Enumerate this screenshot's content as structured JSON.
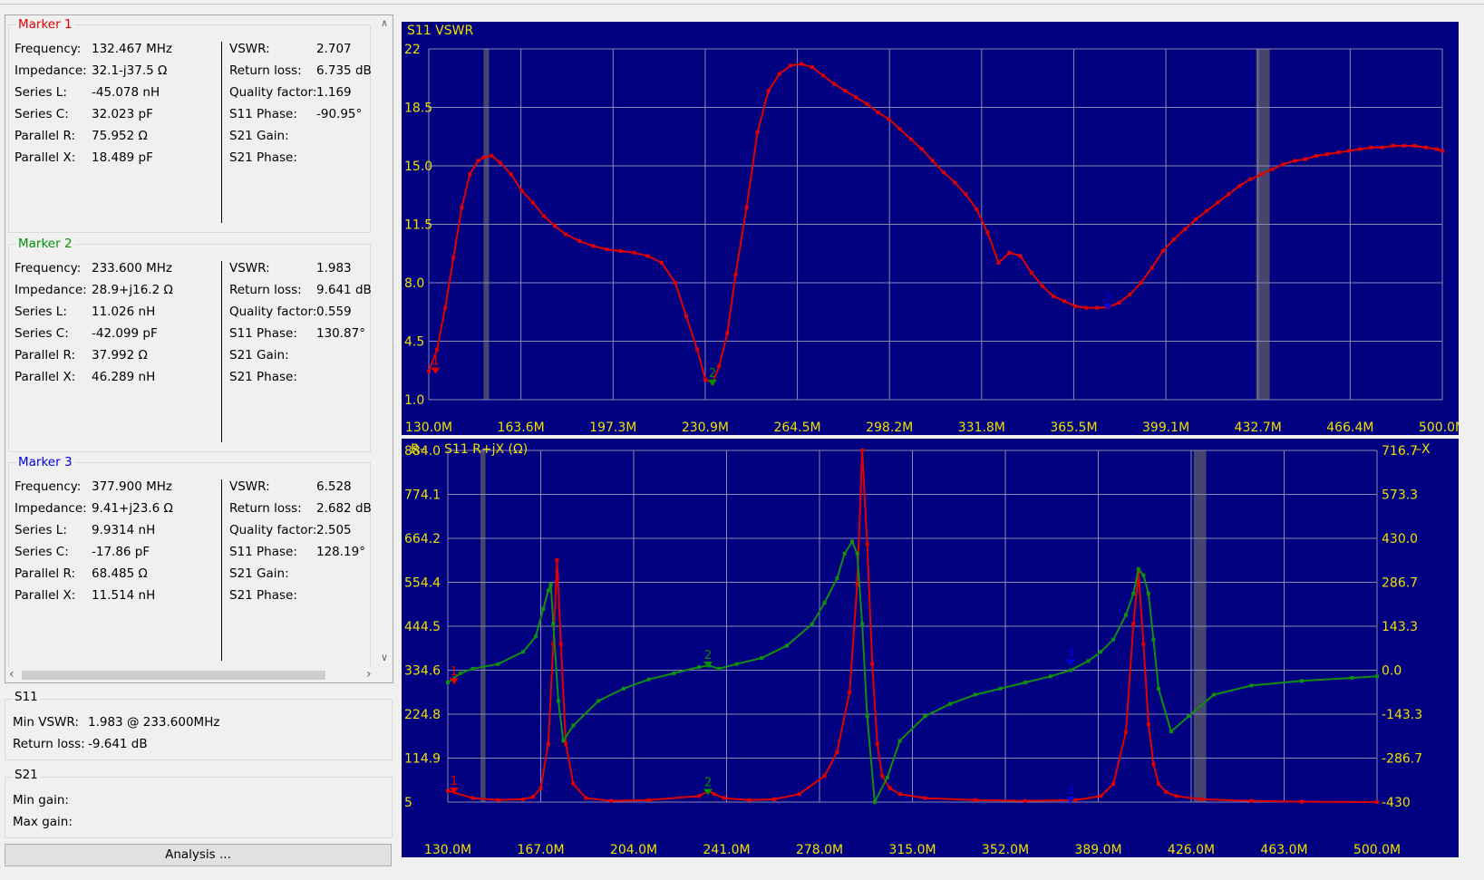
{
  "markers": [
    {
      "title": "Marker 1",
      "color": "#e00000",
      "left": [
        {
          "label": "Frequency:",
          "value": "132.467 MHz"
        },
        {
          "label": "Impedance:",
          "value": "32.1-j37.5 Ω"
        },
        {
          "label": "Series L:",
          "value": "-45.078 nH"
        },
        {
          "label": "Series C:",
          "value": "32.023 pF"
        },
        {
          "label": "Parallel R:",
          "value": "75.952 Ω"
        },
        {
          "label": "Parallel X:",
          "value": "18.489 pF"
        }
      ],
      "right": [
        {
          "label": "VSWR:",
          "value": "2.707"
        },
        {
          "label": "Return loss:",
          "value": "6.735 dB"
        },
        {
          "label": "Quality factor:",
          "value": "1.169"
        },
        {
          "label": "S11 Phase:",
          "value": "-90.95°"
        },
        {
          "label": "S21 Gain:",
          "value": ""
        },
        {
          "label": "S21 Phase:",
          "value": ""
        }
      ]
    },
    {
      "title": "Marker 2",
      "color": "#009000",
      "left": [
        {
          "label": "Frequency:",
          "value": "233.600 MHz"
        },
        {
          "label": "Impedance:",
          "value": "28.9+j16.2 Ω"
        },
        {
          "label": "Series L:",
          "value": "11.026 nH"
        },
        {
          "label": "Series C:",
          "value": "-42.099 pF"
        },
        {
          "label": "Parallel R:",
          "value": "37.992 Ω"
        },
        {
          "label": "Parallel X:",
          "value": "46.289 nH"
        }
      ],
      "right": [
        {
          "label": "VSWR:",
          "value": "1.983"
        },
        {
          "label": "Return loss:",
          "value": "9.641 dB"
        },
        {
          "label": "Quality factor:",
          "value": "0.559"
        },
        {
          "label": "S11 Phase:",
          "value": "130.87°"
        },
        {
          "label": "S21 Gain:",
          "value": ""
        },
        {
          "label": "S21 Phase:",
          "value": ""
        }
      ]
    },
    {
      "title": "Marker 3",
      "color": "#0000e0",
      "left": [
        {
          "label": "Frequency:",
          "value": "377.900 MHz"
        },
        {
          "label": "Impedance:",
          "value": "9.41+j23.6 Ω"
        },
        {
          "label": "Series L:",
          "value": "9.9314 nH"
        },
        {
          "label": "Series C:",
          "value": "-17.86 pF"
        },
        {
          "label": "Parallel R:",
          "value": "68.485 Ω"
        },
        {
          "label": "Parallel X:",
          "value": "11.514 nH"
        }
      ],
      "right": [
        {
          "label": "VSWR:",
          "value": "6.528"
        },
        {
          "label": "Return loss:",
          "value": "2.682 dB"
        },
        {
          "label": "Quality factor:",
          "value": "2.505"
        },
        {
          "label": "S11 Phase:",
          "value": "128.19°"
        },
        {
          "label": "S21 Gain:",
          "value": ""
        },
        {
          "label": "S21 Phase:",
          "value": ""
        }
      ]
    }
  ],
  "s11_summary": {
    "title": "S11",
    "min_vswr_label": "Min VSWR:",
    "min_vswr_value": "1.983 @ 233.600MHz",
    "return_loss_label": "Return loss:",
    "return_loss_value": "-9.641 dB"
  },
  "s21_summary": {
    "title": "S21",
    "min_gain_label": "Min gain:",
    "max_gain_label": "Max gain:"
  },
  "analysis_button": "Analysis ...",
  "chart_data": [
    {
      "type": "line",
      "title": "S11 VSWR",
      "x_tick_labels": [
        "130.0M",
        "163.6M",
        "197.3M",
        "230.9M",
        "264.5M",
        "298.2M",
        "331.8M",
        "365.5M",
        "399.1M",
        "432.7M",
        "466.4M",
        "500.0M"
      ],
      "y_tick_labels": [
        "22",
        "18.5",
        "15.0",
        "11.5",
        "8.0",
        "4.5",
        "1.0"
      ],
      "xlim": [
        130,
        500
      ],
      "ylim": [
        1,
        22
      ],
      "grid": true,
      "background": "#000080",
      "series": [
        {
          "color": "#e00000",
          "x": [
            130,
            133,
            136,
            139,
            142,
            145,
            148,
            150,
            153,
            156,
            160,
            164,
            168,
            172,
            176,
            180,
            185,
            190,
            195,
            200,
            205,
            210,
            215,
            220,
            224,
            228,
            231,
            233.6,
            236,
            239,
            242,
            246,
            250,
            254,
            258,
            262,
            266,
            270,
            274,
            278,
            282,
            286,
            290,
            294,
            298,
            302,
            306,
            310,
            314,
            318,
            322,
            326,
            330,
            334,
            338,
            342,
            346,
            350,
            354,
            358,
            362,
            366,
            370,
            374,
            377.9,
            382,
            386,
            390,
            394,
            398,
            402,
            406,
            410,
            414,
            418,
            422,
            426,
            430,
            434,
            438,
            442,
            446,
            450,
            454,
            458,
            462,
            466,
            470,
            474,
            478,
            482,
            486,
            490,
            494,
            498,
            500
          ],
          "y": [
            2.7,
            4.0,
            6.5,
            9.5,
            12.5,
            14.5,
            15.3,
            15.5,
            15.6,
            15.2,
            14.5,
            13.5,
            12.8,
            12.0,
            11.4,
            10.9,
            10.5,
            10.2,
            10.0,
            9.9,
            9.8,
            9.6,
            9.2,
            8.0,
            6.0,
            4.0,
            2.2,
            2.0,
            3.0,
            5.0,
            8.5,
            12.5,
            17.0,
            19.5,
            20.5,
            21.0,
            21.1,
            20.9,
            20.4,
            19.9,
            19.5,
            19.1,
            18.7,
            18.2,
            17.8,
            17.2,
            16.6,
            16.0,
            15.3,
            14.6,
            14.0,
            13.3,
            12.4,
            11.0,
            9.2,
            9.8,
            9.6,
            8.6,
            7.8,
            7.2,
            6.9,
            6.6,
            6.5,
            6.5,
            6.53,
            6.8,
            7.3,
            8.0,
            8.9,
            9.9,
            10.6,
            11.2,
            11.8,
            12.3,
            12.8,
            13.3,
            13.8,
            14.2,
            14.5,
            14.8,
            15.1,
            15.3,
            15.4,
            15.6,
            15.7,
            15.8,
            15.9,
            16.0,
            16.1,
            16.1,
            16.2,
            16.2,
            16.2,
            16.1,
            16.0,
            15.9
          ]
        }
      ],
      "markers": [
        {
          "label": "1",
          "x": 132.467,
          "y": 2.707,
          "color": "#e00000"
        },
        {
          "label": "2",
          "x": 233.6,
          "y": 1.983,
          "color": "#009000"
        },
        {
          "label": "3",
          "x": 377.9,
          "y": 6.528,
          "color": "#0000e0"
        }
      ],
      "shaded_bands": [
        [
          150,
          152
        ],
        [
          432,
          437
        ]
      ]
    },
    {
      "type": "line",
      "title": "S11 R+jX (Ω)",
      "left_axis_label": "R",
      "right_axis_label": "X",
      "x_tick_labels": [
        "130.0M",
        "167.0M",
        "204.0M",
        "241.0M",
        "278.0M",
        "315.0M",
        "352.0M",
        "389.0M",
        "426.0M",
        "463.0M",
        "500.0M"
      ],
      "y_tick_labels": [
        "884.0",
        "774.1",
        "664.2",
        "554.4",
        "444.5",
        "334.6",
        "224.8",
        "114.9",
        "5"
      ],
      "y2_tick_labels": [
        "716.7",
        "573.3",
        "430.0",
        "286.7",
        "143.3",
        "0.0",
        "-143.3",
        "-286.7",
        "-430"
      ],
      "xlim": [
        130,
        500
      ],
      "ylim": [
        5,
        884
      ],
      "y2lim": [
        -430,
        716.7
      ],
      "grid": true,
      "background": "#000080",
      "series": [
        {
          "name": "R",
          "color": "#e00000",
          "x": [
            130,
            140,
            150,
            160,
            164,
            167,
            170,
            172,
            173.5,
            175,
            177,
            180,
            185,
            195,
            210,
            230,
            234,
            236,
            240,
            250,
            260,
            270,
            280,
            285,
            290,
            293,
            295,
            297,
            299,
            301,
            303,
            306,
            310,
            320,
            340,
            360,
            380,
            390,
            395,
            400,
            403,
            405,
            407,
            409,
            411,
            413,
            416,
            420,
            430,
            450,
            470,
            500
          ],
          "y": [
            33,
            15,
            10,
            12,
            18,
            40,
            150,
            400,
            610,
            400,
            150,
            50,
            15,
            8,
            10,
            20,
            33,
            25,
            15,
            10,
            12,
            25,
            70,
            130,
            280,
            550,
            884,
            650,
            350,
            150,
            70,
            40,
            25,
            15,
            10,
            8,
            10,
            20,
            50,
            180,
            450,
            580,
            400,
            200,
            100,
            50,
            30,
            20,
            12,
            8,
            6,
            5
          ]
        },
        {
          "name": "X",
          "color": "#109010",
          "x": [
            130,
            135,
            140,
            150,
            160,
            165,
            168,
            170,
            171,
            172,
            174,
            176,
            180,
            190,
            200,
            210,
            220,
            230,
            234,
            238,
            245,
            255,
            265,
            275,
            280,
            285,
            288,
            291,
            293,
            295,
            297,
            300,
            305,
            310,
            320,
            330,
            340,
            350,
            360,
            370,
            378,
            385,
            390,
            395,
            400,
            403,
            405,
            407,
            409,
            411,
            413,
            418,
            425,
            435,
            450,
            470,
            490,
            500
          ],
          "y": [
            -40,
            -10,
            5,
            20,
            60,
            110,
            200,
            260,
            280,
            150,
            -100,
            -230,
            -180,
            -100,
            -60,
            -30,
            -10,
            10,
            15,
            5,
            20,
            40,
            80,
            150,
            220,
            300,
            380,
            420,
            380,
            150,
            -150,
            -430,
            -350,
            -230,
            -150,
            -110,
            -80,
            -60,
            -40,
            -20,
            0,
            30,
            60,
            100,
            180,
            250,
            330,
            310,
            250,
            100,
            -60,
            -200,
            -150,
            -80,
            -50,
            -35,
            -25,
            -20
          ]
        }
      ],
      "markers": [
        {
          "label": "1",
          "x": 132.467,
          "r": 32.1,
          "x_value": -37.5,
          "color": "#e00000"
        },
        {
          "label": "2",
          "x": 233.6,
          "r": 28.9,
          "x_value": 16.2,
          "color": "#009000"
        },
        {
          "label": "3",
          "x": 377.9,
          "r": 9.41,
          "x_value": 23.6,
          "color": "#0000e0"
        }
      ],
      "shaded_bands": [
        [
          143,
          145
        ],
        [
          427,
          432
        ]
      ]
    }
  ]
}
